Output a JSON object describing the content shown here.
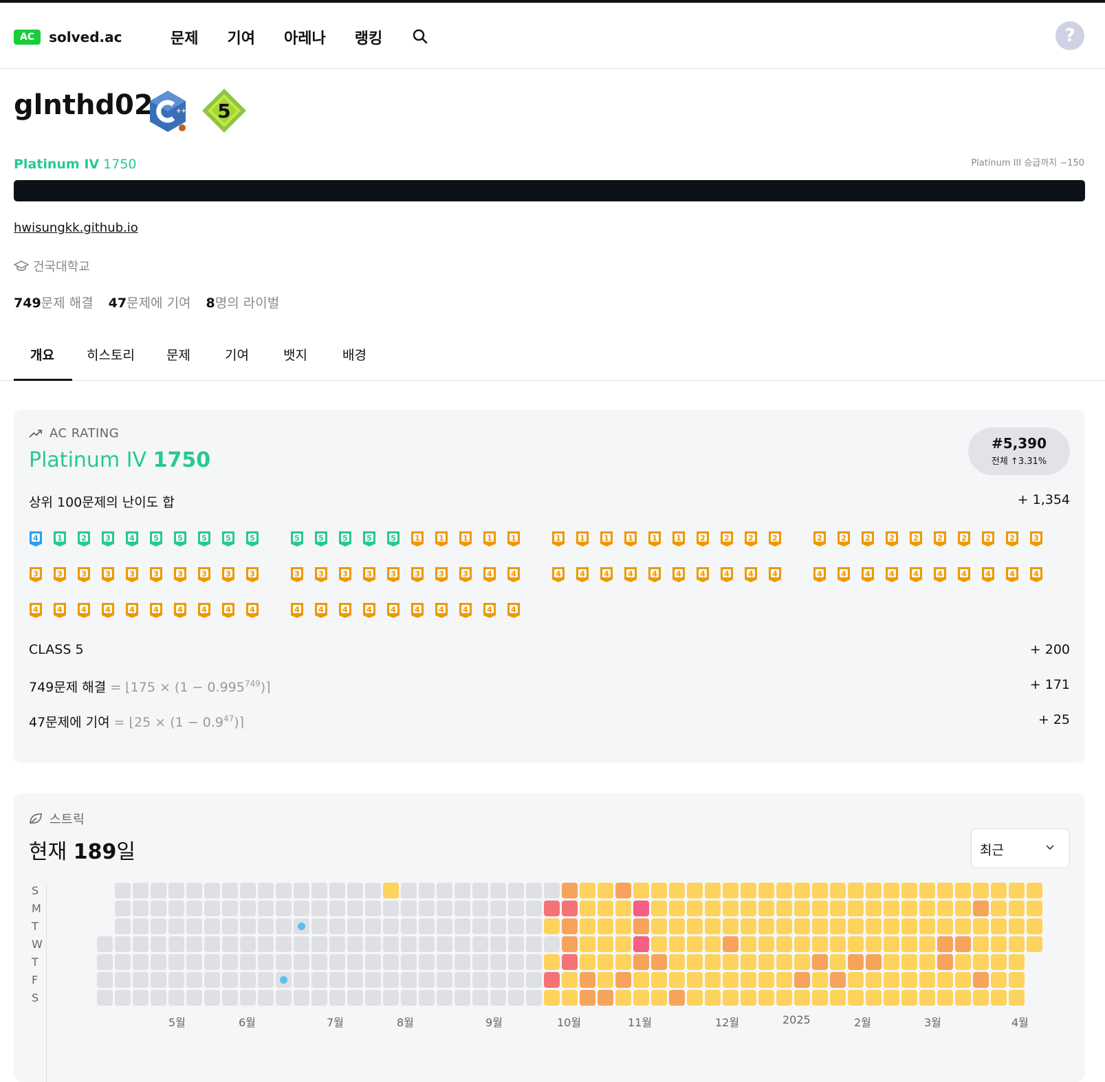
{
  "nav": {
    "logo_badge": "AC",
    "logo_text": "solved.ac",
    "items": [
      "문제",
      "기여",
      "아레나",
      "랭킹"
    ],
    "help": "?"
  },
  "profile": {
    "username": "glnthd02",
    "tier_name": "Platinum IV",
    "rating": "1750",
    "promo_text": "Platinum III 승급까지 −150",
    "link": "hwisungkk.github.io",
    "school": "건국대학교",
    "stats": [
      {
        "num": "749",
        "label": "문제 해결"
      },
      {
        "num": "47",
        "label": "문제에 기여"
      },
      {
        "num": "8",
        "label": "명의 라이벌"
      }
    ],
    "class_badge": "5",
    "colors": {
      "platinum": "#27c98f",
      "accent_dark": "#0d1118"
    }
  },
  "tabs": [
    "개요",
    "히스토리",
    "문제",
    "기여",
    "뱃지",
    "배경"
  ],
  "rating_card": {
    "header": "AC RATING",
    "tier_name": "Platinum IV",
    "rating": "1750",
    "rank": "#5,390",
    "rank_sub": "전체 ↑3.31%",
    "top100_label": "상위 100문제의 난이도 합",
    "top100_value": "+ 1,354",
    "class_label": "CLASS 5",
    "class_value": "+ 200",
    "solved_label": "749문제 해결",
    "solved_formula_a": "= ⌊175 × (1 − 0.995",
    "solved_formula_exp": "749",
    "solved_formula_b": ")⌉",
    "solved_value": "+ 171",
    "contrib_label": "47문제에 기여",
    "contrib_formula_a": "= ⌊25 × (1 − 0.9",
    "contrib_formula_exp": "47",
    "contrib_formula_b": ")⌉",
    "contrib_value": "+ 25",
    "top100_tiers": [
      {
        "tier": "diamond",
        "level": "4"
      },
      {
        "tier": "platinum",
        "level": "1"
      },
      {
        "tier": "platinum",
        "level": "2"
      },
      {
        "tier": "platinum",
        "level": "3"
      },
      {
        "tier": "platinum",
        "level": "4"
      },
      {
        "tier": "platinum",
        "level": "5"
      },
      {
        "tier": "platinum",
        "level": "5"
      },
      {
        "tier": "platinum",
        "level": "5"
      },
      {
        "tier": "platinum",
        "level": "5"
      },
      {
        "tier": "platinum",
        "level": "5"
      },
      {
        "tier": "platinum",
        "level": "5"
      },
      {
        "tier": "platinum",
        "level": "5"
      },
      {
        "tier": "platinum",
        "level": "5"
      },
      {
        "tier": "platinum",
        "level": "5"
      },
      {
        "tier": "platinum",
        "level": "5"
      },
      {
        "tier": "gold",
        "level": "1"
      },
      {
        "tier": "gold",
        "level": "1"
      },
      {
        "tier": "gold",
        "level": "1"
      },
      {
        "tier": "gold",
        "level": "1"
      },
      {
        "tier": "gold",
        "level": "1"
      },
      {
        "tier": "gold",
        "level": "1"
      },
      {
        "tier": "gold",
        "level": "1"
      },
      {
        "tier": "gold",
        "level": "1"
      },
      {
        "tier": "gold",
        "level": "1"
      },
      {
        "tier": "gold",
        "level": "1"
      },
      {
        "tier": "gold",
        "level": "1"
      },
      {
        "tier": "gold",
        "level": "2"
      },
      {
        "tier": "gold",
        "level": "2"
      },
      {
        "tier": "gold",
        "level": "2"
      },
      {
        "tier": "gold",
        "level": "2"
      },
      {
        "tier": "gold",
        "level": "2"
      },
      {
        "tier": "gold",
        "level": "2"
      },
      {
        "tier": "gold",
        "level": "2"
      },
      {
        "tier": "gold",
        "level": "2"
      },
      {
        "tier": "gold",
        "level": "2"
      },
      {
        "tier": "gold",
        "level": "2"
      },
      {
        "tier": "gold",
        "level": "2"
      },
      {
        "tier": "gold",
        "level": "2"
      },
      {
        "tier": "gold",
        "level": "2"
      },
      {
        "tier": "gold",
        "level": "3"
      },
      {
        "tier": "gold",
        "level": "3"
      },
      {
        "tier": "gold",
        "level": "3"
      },
      {
        "tier": "gold",
        "level": "3"
      },
      {
        "tier": "gold",
        "level": "3"
      },
      {
        "tier": "gold",
        "level": "3"
      },
      {
        "tier": "gold",
        "level": "3"
      },
      {
        "tier": "gold",
        "level": "3"
      },
      {
        "tier": "gold",
        "level": "3"
      },
      {
        "tier": "gold",
        "level": "3"
      },
      {
        "tier": "gold",
        "level": "3"
      },
      {
        "tier": "gold",
        "level": "3"
      },
      {
        "tier": "gold",
        "level": "3"
      },
      {
        "tier": "gold",
        "level": "3"
      },
      {
        "tier": "gold",
        "level": "3"
      },
      {
        "tier": "gold",
        "level": "3"
      },
      {
        "tier": "gold",
        "level": "3"
      },
      {
        "tier": "gold",
        "level": "3"
      },
      {
        "tier": "gold",
        "level": "3"
      },
      {
        "tier": "gold",
        "level": "4"
      },
      {
        "tier": "gold",
        "level": "4"
      },
      {
        "tier": "gold",
        "level": "4"
      },
      {
        "tier": "gold",
        "level": "4"
      },
      {
        "tier": "gold",
        "level": "4"
      },
      {
        "tier": "gold",
        "level": "4"
      },
      {
        "tier": "gold",
        "level": "4"
      },
      {
        "tier": "gold",
        "level": "4"
      },
      {
        "tier": "gold",
        "level": "4"
      },
      {
        "tier": "gold",
        "level": "4"
      },
      {
        "tier": "gold",
        "level": "4"
      },
      {
        "tier": "gold",
        "level": "4"
      },
      {
        "tier": "gold",
        "level": "4"
      },
      {
        "tier": "gold",
        "level": "4"
      },
      {
        "tier": "gold",
        "level": "4"
      },
      {
        "tier": "gold",
        "level": "4"
      },
      {
        "tier": "gold",
        "level": "4"
      },
      {
        "tier": "gold",
        "level": "4"
      },
      {
        "tier": "gold",
        "level": "4"
      },
      {
        "tier": "gold",
        "level": "4"
      },
      {
        "tier": "gold",
        "level": "4"
      },
      {
        "tier": "gold",
        "level": "4"
      },
      {
        "tier": "gold",
        "level": "4"
      },
      {
        "tier": "gold",
        "level": "4"
      },
      {
        "tier": "gold",
        "level": "4"
      },
      {
        "tier": "gold",
        "level": "4"
      },
      {
        "tier": "gold",
        "level": "4"
      },
      {
        "tier": "gold",
        "level": "4"
      },
      {
        "tier": "gold",
        "level": "4"
      },
      {
        "tier": "gold",
        "level": "4"
      },
      {
        "tier": "gold",
        "level": "4"
      },
      {
        "tier": "gold",
        "level": "4"
      },
      {
        "tier": "gold",
        "level": "4"
      },
      {
        "tier": "gold",
        "level": "4"
      },
      {
        "tier": "gold",
        "level": "4"
      },
      {
        "tier": "gold",
        "level": "4"
      },
      {
        "tier": "gold",
        "level": "4"
      },
      {
        "tier": "gold",
        "level": "4"
      },
      {
        "tier": "gold",
        "level": "4"
      },
      {
        "tier": "gold",
        "level": "4"
      },
      {
        "tier": "gold",
        "level": "4"
      },
      {
        "tier": "gold",
        "level": "4"
      }
    ],
    "tier_colors": {
      "diamond": "#2a9fef",
      "platinum": "#27c98f",
      "gold": "#ec9a00"
    }
  },
  "streak_card": {
    "header": "스트릭",
    "title_prefix": "현재",
    "days": "189",
    "title_suffix": "일",
    "dropdown_value": "최근",
    "day_labels": [
      "S",
      "M",
      "T",
      "W",
      "T",
      "F",
      "S"
    ],
    "months": [
      "5월",
      "6월",
      "7월",
      "8월",
      "9월",
      "10월",
      "11월",
      "12월",
      "2025",
      "2월",
      "3월",
      "4월"
    ],
    "level_colors": {
      "0": "#dfe0e3",
      "1": "#fdd35e",
      "2": "#f7a35c",
      "3": "#f57377",
      "4": "#f55e85",
      "frozen": "#5bc0eb"
    },
    "week_columns": 53,
    "overrides": [
      {
        "week": 16,
        "day": 0,
        "level": "1"
      },
      {
        "week": 11,
        "day": 2,
        "level": "frozen"
      },
      {
        "week": 10,
        "day": 5,
        "level": "frozen"
      },
      {
        "week": 26,
        "day": 0,
        "level": "2"
      },
      {
        "week": 29,
        "day": 0,
        "level": "2"
      },
      {
        "week": 25,
        "day": 1,
        "level": "3"
      },
      {
        "week": 26,
        "day": 1,
        "level": "3"
      },
      {
        "week": 30,
        "day": 1,
        "level": "4"
      },
      {
        "week": 26,
        "day": 2,
        "level": "2"
      },
      {
        "week": 30,
        "day": 2,
        "level": "2"
      },
      {
        "week": 26,
        "day": 3,
        "level": "2"
      },
      {
        "week": 30,
        "day": 3,
        "level": "4"
      },
      {
        "week": 35,
        "day": 3,
        "level": "2"
      },
      {
        "week": 26,
        "day": 4,
        "level": "3"
      },
      {
        "week": 30,
        "day": 4,
        "level": "2"
      },
      {
        "week": 31,
        "day": 4,
        "level": "2"
      },
      {
        "week": 25,
        "day": 5,
        "level": "3"
      },
      {
        "week": 27,
        "day": 5,
        "level": "2"
      },
      {
        "week": 29,
        "day": 5,
        "level": "2"
      },
      {
        "week": 27,
        "day": 6,
        "level": "2"
      },
      {
        "week": 28,
        "day": 6,
        "level": "2"
      },
      {
        "week": 32,
        "day": 6,
        "level": "2"
      },
      {
        "week": 49,
        "day": 1,
        "level": "2"
      },
      {
        "week": 47,
        "day": 3,
        "level": "2"
      },
      {
        "week": 48,
        "day": 3,
        "level": "2"
      },
      {
        "week": 40,
        "day": 4,
        "level": "2"
      },
      {
        "week": 42,
        "day": 4,
        "level": "2"
      },
      {
        "week": 43,
        "day": 4,
        "level": "2"
      },
      {
        "week": 47,
        "day": 4,
        "level": "2"
      },
      {
        "week": 39,
        "day": 5,
        "level": "2"
      },
      {
        "week": 41,
        "day": 5,
        "level": "2"
      },
      {
        "week": 49,
        "day": 5,
        "level": "2"
      }
    ]
  }
}
